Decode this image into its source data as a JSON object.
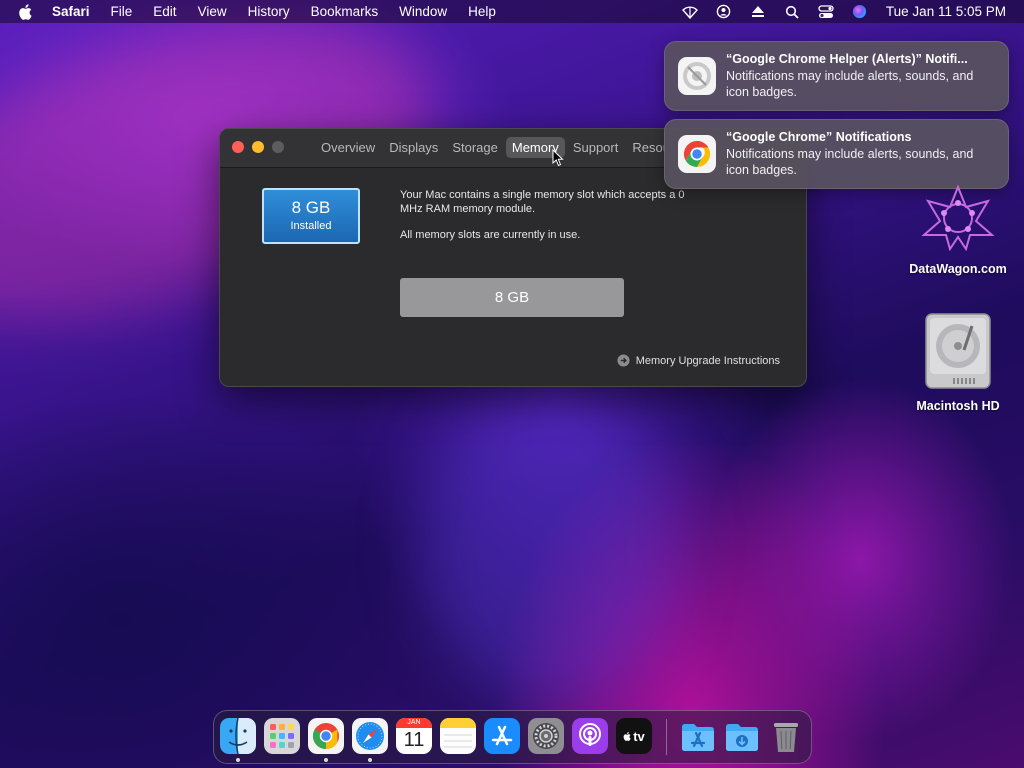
{
  "menubar": {
    "items": [
      "Safari",
      "File",
      "Edit",
      "View",
      "History",
      "Bookmarks",
      "Window",
      "Help"
    ],
    "clock": "Tue Jan 11  5:05 PM",
    "status_icons": [
      "wifi-icon",
      "user-icon",
      "eject-icon",
      "search-icon",
      "control-center-icon",
      "siri-icon"
    ]
  },
  "window": {
    "tabs": [
      "Overview",
      "Displays",
      "Storage",
      "Memory",
      "Support",
      "Resources"
    ],
    "active_tab": "Memory",
    "memory_tile": {
      "size": "8 GB",
      "label": "Installed"
    },
    "info": {
      "line1": "Your Mac contains a single memory slot which accepts a 0 MHz RAM memory module.",
      "line2": "All memory slots are currently in use."
    },
    "slot_label": "8 GB",
    "upgrade_link": "Memory Upgrade Instructions"
  },
  "notifications": [
    {
      "title": "“Google Chrome Helper (Alerts)” Notifi...",
      "body": "Notifications may include alerts, sounds, and icon badges."
    },
    {
      "title": "“Google Chrome” Notifications",
      "body": "Notifications may include alerts, sounds, and icon badges."
    }
  ],
  "desktop": {
    "icons": [
      "DataWagon.com",
      "Macintosh HD"
    ]
  },
  "dock": {
    "apps": [
      "Finder",
      "Launchpad",
      "Google Chrome",
      "Safari",
      "Calendar",
      "Notes",
      "App Store",
      "System Preferences",
      "Podcasts",
      "TV",
      "Applications",
      "Downloads",
      "Trash"
    ],
    "calendar_month": "JAN",
    "calendar_day": "11",
    "tv_label": "tv"
  }
}
